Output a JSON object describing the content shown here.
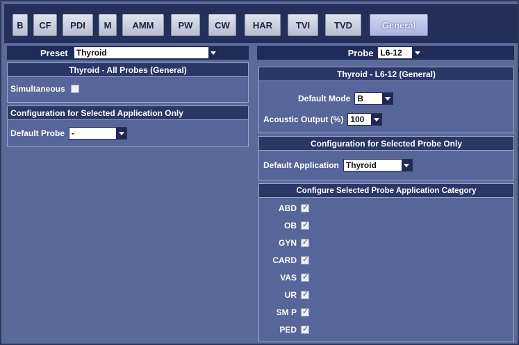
{
  "tabs": [
    {
      "label": "B",
      "active": false
    },
    {
      "label": "CF",
      "active": false
    },
    {
      "label": "PDI",
      "active": false
    },
    {
      "label": "M",
      "active": false
    },
    {
      "label": "AMM",
      "active": false
    },
    {
      "label": "PW",
      "active": false
    },
    {
      "label": "CW",
      "active": false
    },
    {
      "label": "HAR",
      "active": false
    },
    {
      "label": "TVI",
      "active": false
    },
    {
      "label": "TVD",
      "active": false
    },
    {
      "label": "General",
      "active": true
    }
  ],
  "left": {
    "preset_label": "Preset",
    "preset_value": "Thyroid",
    "all_probes_title": "Thyroid - All Probes (General)",
    "simultaneous_label": "Simultaneous",
    "simultaneous_checked": false,
    "app_config_title": "Configuration for Selected Application Only",
    "default_probe_label": "Default Probe",
    "default_probe_value": "-"
  },
  "right": {
    "probe_label": "Probe",
    "probe_value": "L6-12",
    "probe_title": "Thyroid - L6-12 (General)",
    "default_mode_label": "Default Mode",
    "default_mode_value": "B",
    "acoustic_output_label": "Acoustic Output (%)",
    "acoustic_output_value": "100",
    "probe_config_title": "Configuration for Selected Probe Only",
    "default_application_label": "Default Application",
    "default_application_value": "Thyroid",
    "category_title": "Configure Selected Probe Application Category",
    "categories": [
      {
        "label": "ABD",
        "checked": true
      },
      {
        "label": "OB",
        "checked": true
      },
      {
        "label": "GYN",
        "checked": true
      },
      {
        "label": "CARD",
        "checked": true
      },
      {
        "label": "VAS",
        "checked": true
      },
      {
        "label": "UR",
        "checked": true
      },
      {
        "label": "SM P",
        "checked": true
      },
      {
        "label": "PED",
        "checked": true
      }
    ]
  },
  "colors": {
    "background": "#5a6a9a",
    "header_bar": "#1f2b58",
    "panel_head": "#2a3868",
    "tab_active": "#aab6df"
  }
}
